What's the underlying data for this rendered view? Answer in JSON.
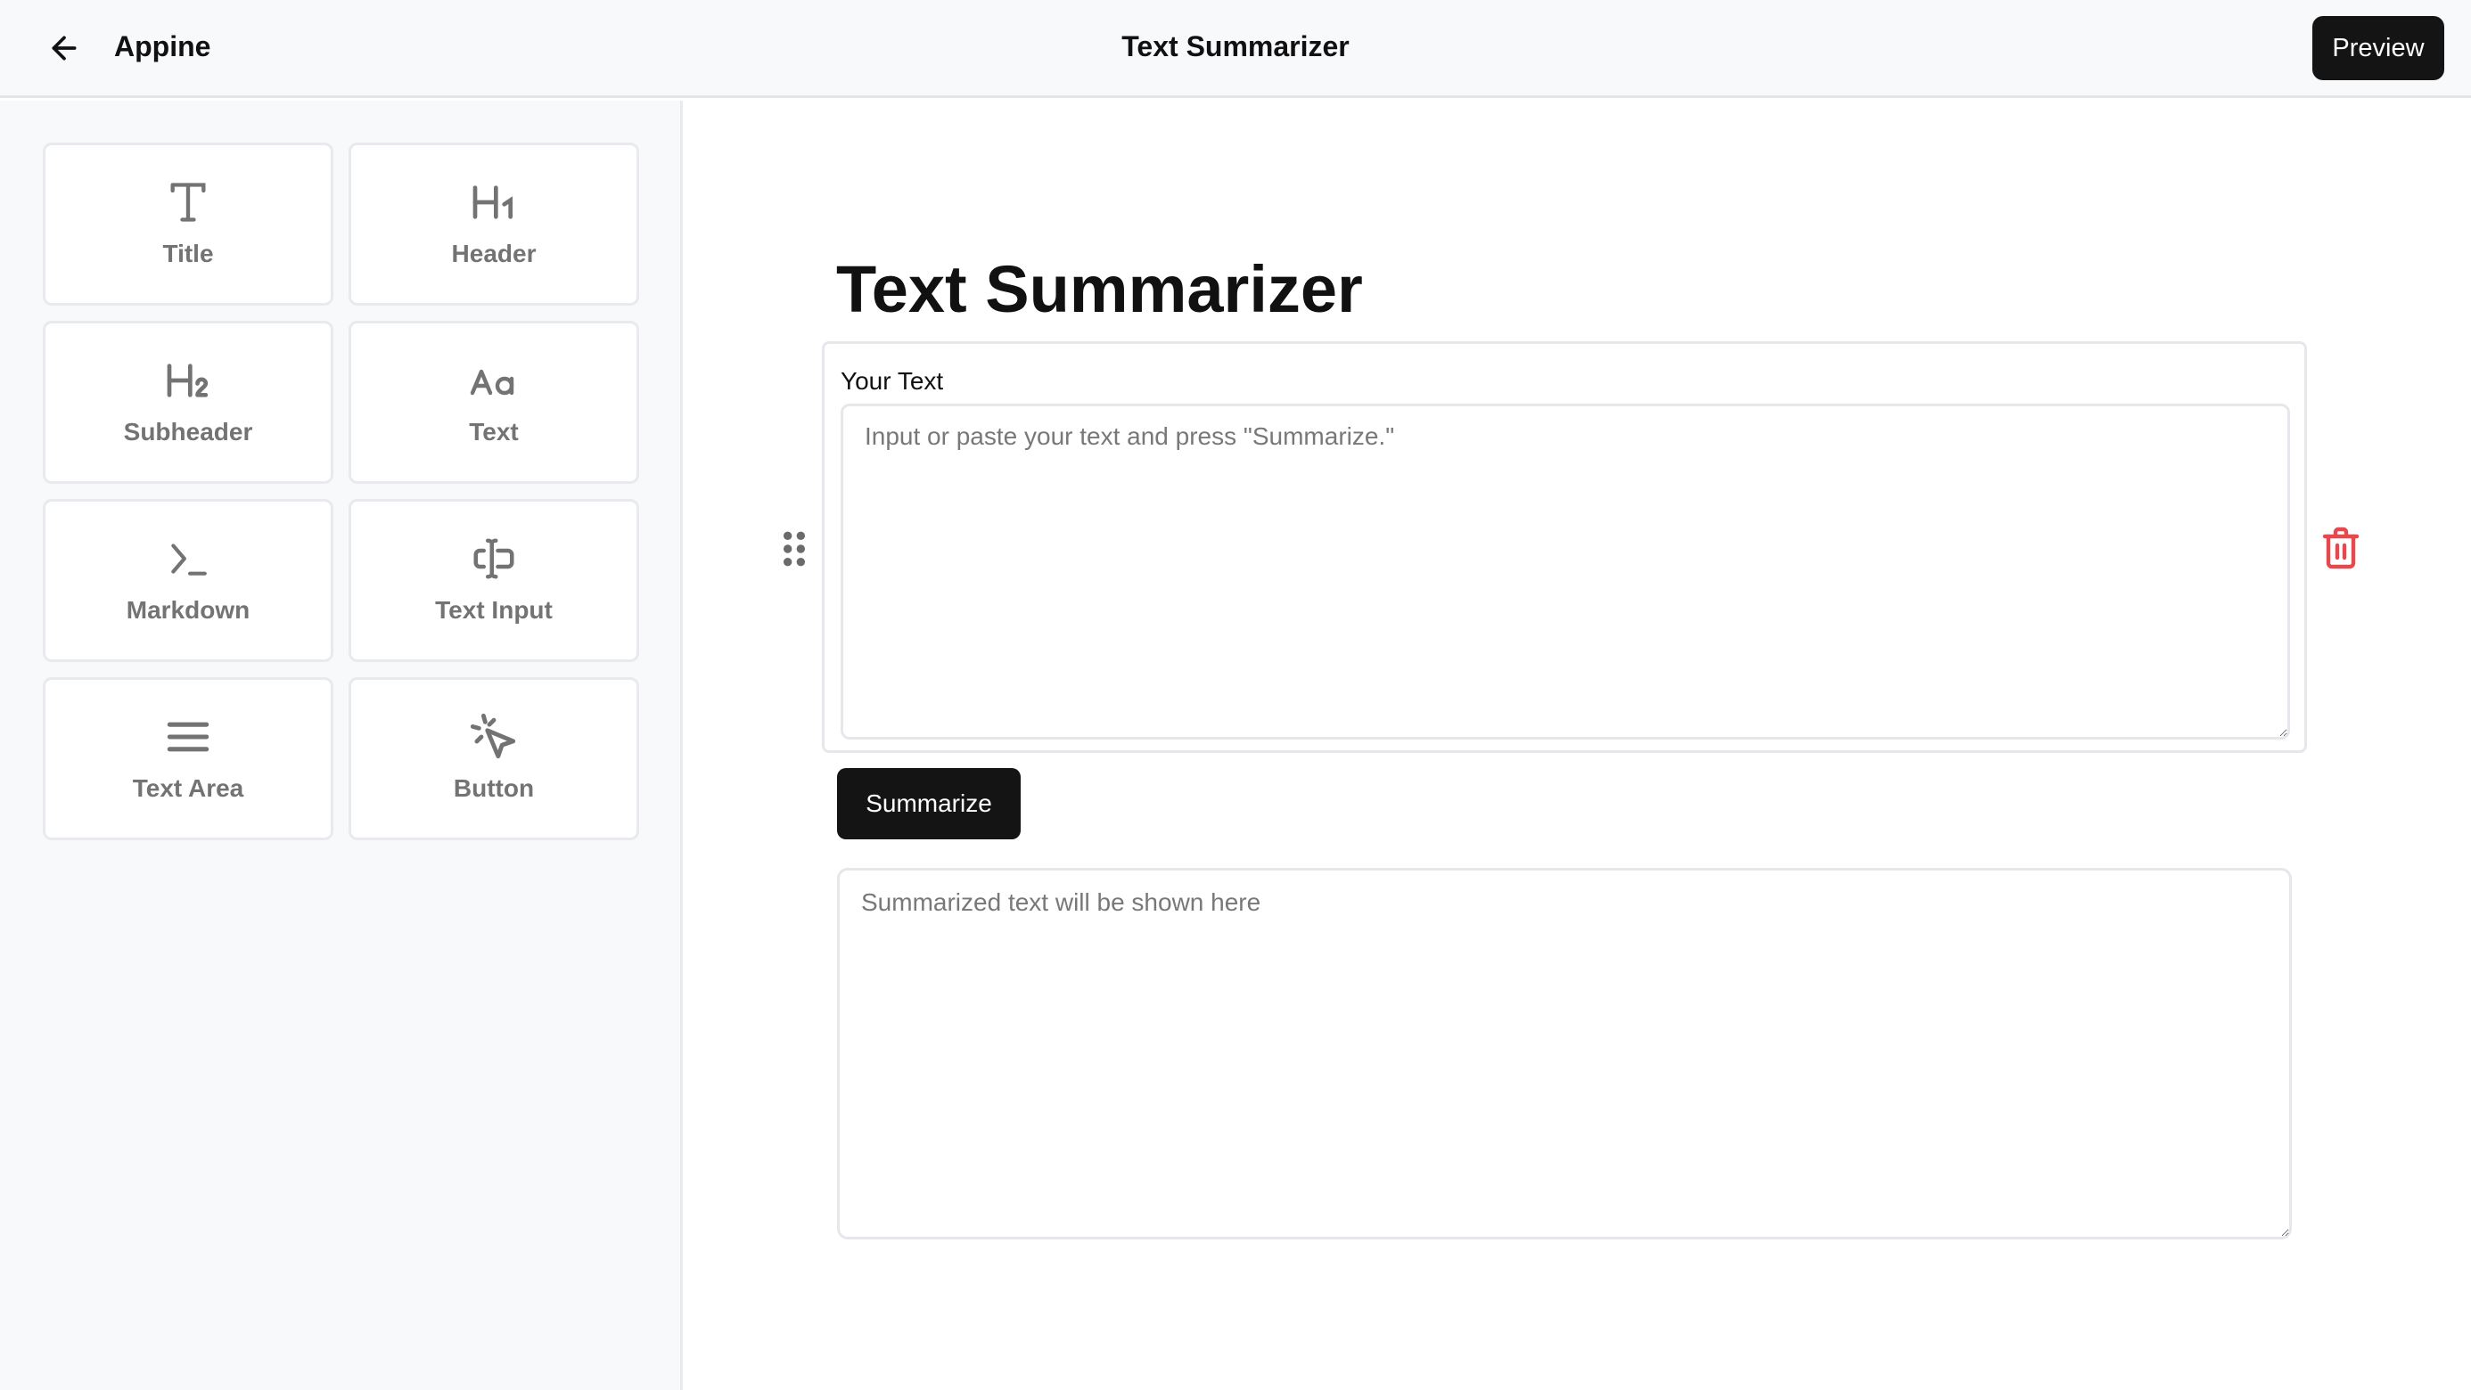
{
  "topbar": {
    "back_icon": "arrow-left-icon",
    "app_name": "Appine",
    "page_title": "Text Summarizer",
    "preview_label": "Preview"
  },
  "sidebar": {
    "components": [
      {
        "label": "Title",
        "icon": "title-T-icon"
      },
      {
        "label": "Header",
        "icon": "heading-1-icon"
      },
      {
        "label": "Subheader",
        "icon": "heading-2-icon"
      },
      {
        "label": "Text",
        "icon": "text-Aa-icon"
      },
      {
        "label": "Markdown",
        "icon": "terminal-prompt-icon"
      },
      {
        "label": "Text Input",
        "icon": "text-cursor-input-icon"
      },
      {
        "label": "Text Area",
        "icon": "lines-icon"
      },
      {
        "label": "Button",
        "icon": "pointer-click-icon"
      }
    ]
  },
  "canvas": {
    "title": "Text Summarizer",
    "input_block": {
      "label": "Your Text",
      "value": "",
      "placeholder": "Input or paste your text and press \"Summarize.\""
    },
    "summarize_label": "Summarize",
    "output": {
      "value": "",
      "placeholder": "Summarized text will be shown here"
    },
    "delete_icon": "trash-icon",
    "drag_icon": "grip-vertical-icon"
  },
  "colors": {
    "primary_button": "#141414",
    "danger": "#e5484d",
    "icon_gray": "#737373",
    "sidebar_bg": "#f8f9fb",
    "border": "#e6e7eb"
  }
}
